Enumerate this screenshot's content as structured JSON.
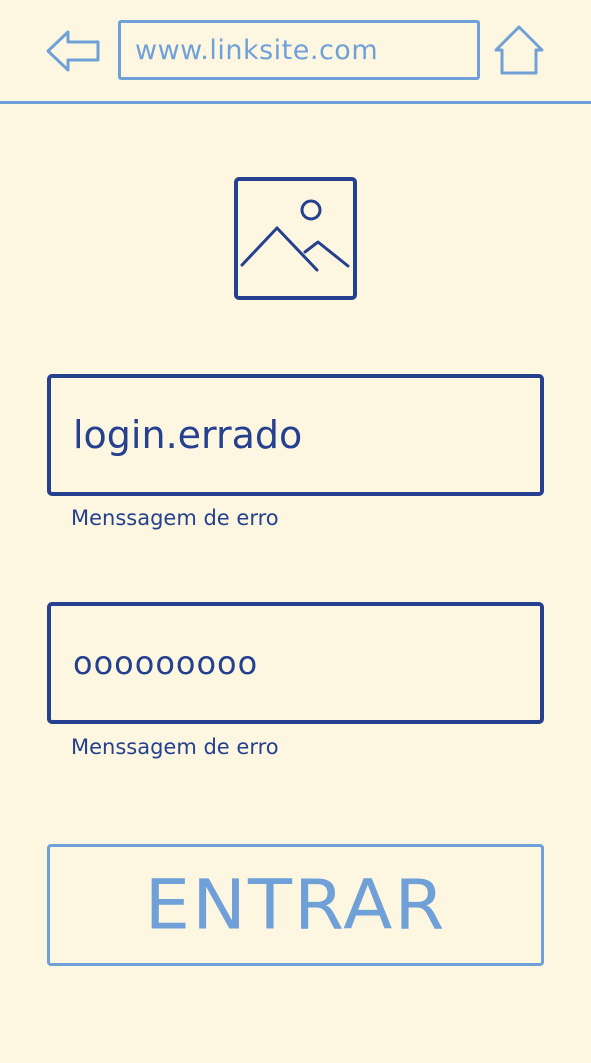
{
  "browser": {
    "url": "www.linksite.com",
    "back_icon": "arrow-left-icon",
    "home_icon": "home-icon"
  },
  "content": {
    "image_icon": "image-placeholder-icon",
    "login": {
      "value": "login.errado",
      "error": "Menssagem de erro"
    },
    "password": {
      "value": "ooooooooo",
      "error": "Menssagem de erro"
    },
    "submit_label": "ENTRAR"
  },
  "colors": {
    "background": "#FDF7E1",
    "accent_light": "#6FA0D8",
    "accent_dark": "#24408E"
  }
}
